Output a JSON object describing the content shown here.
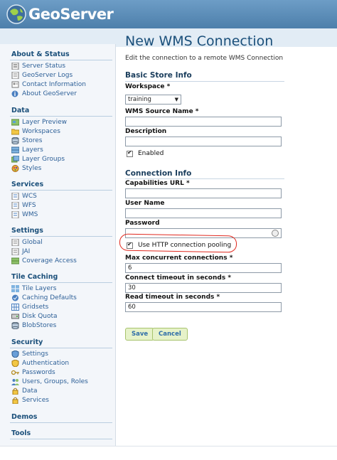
{
  "app": {
    "title": "GeoServer"
  },
  "sidebar": {
    "groups": [
      {
        "title": "About & Status",
        "items": [
          {
            "label": "Server Status",
            "icon": "server-status-icon"
          },
          {
            "label": "GeoServer Logs",
            "icon": "logs-icon"
          },
          {
            "label": "Contact Information",
            "icon": "contact-icon"
          },
          {
            "label": "About GeoServer",
            "icon": "about-icon"
          }
        ]
      },
      {
        "title": "Data",
        "items": [
          {
            "label": "Layer Preview",
            "icon": "layer-preview-icon"
          },
          {
            "label": "Workspaces",
            "icon": "folder-icon"
          },
          {
            "label": "Stores",
            "icon": "database-icon"
          },
          {
            "label": "Layers",
            "icon": "layers-icon"
          },
          {
            "label": "Layer Groups",
            "icon": "layer-groups-icon"
          },
          {
            "label": "Styles",
            "icon": "styles-icon"
          }
        ]
      },
      {
        "title": "Services",
        "items": [
          {
            "label": "WCS",
            "icon": "wcs-icon"
          },
          {
            "label": "WFS",
            "icon": "wfs-icon"
          },
          {
            "label": "WMS",
            "icon": "wms-icon"
          }
        ]
      },
      {
        "title": "Settings",
        "items": [
          {
            "label": "Global",
            "icon": "global-icon"
          },
          {
            "label": "JAI",
            "icon": "jai-icon"
          },
          {
            "label": "Coverage Access",
            "icon": "coverage-icon"
          }
        ]
      },
      {
        "title": "Tile Caching",
        "items": [
          {
            "label": "Tile Layers",
            "icon": "tile-layers-icon"
          },
          {
            "label": "Caching Defaults",
            "icon": "caching-defaults-icon"
          },
          {
            "label": "Gridsets",
            "icon": "gridsets-icon"
          },
          {
            "label": "Disk Quota",
            "icon": "disk-quota-icon"
          },
          {
            "label": "BlobStores",
            "icon": "blobstores-icon"
          }
        ]
      },
      {
        "title": "Security",
        "items": [
          {
            "label": "Settings",
            "icon": "security-settings-icon"
          },
          {
            "label": "Authentication",
            "icon": "authentication-icon"
          },
          {
            "label": "Passwords",
            "icon": "passwords-icon"
          },
          {
            "label": "Users, Groups, Roles",
            "icon": "users-icon"
          },
          {
            "label": "Data",
            "icon": "data-security-icon"
          },
          {
            "label": "Services",
            "icon": "services-security-icon"
          }
        ]
      },
      {
        "title": "Demos",
        "items": []
      },
      {
        "title": "Tools",
        "items": []
      }
    ]
  },
  "main": {
    "title": "New WMS Connection",
    "description": "Edit the connection to a remote WMS Connection",
    "basic_section": "Basic Store Info",
    "workspace_label": "Workspace *",
    "workspace_value": "training",
    "source_name_label": "WMS Source Name *",
    "source_name_value": "",
    "description_label": "Description",
    "description_value": "",
    "enabled_label": "Enabled",
    "connection_section": "Connection Info",
    "capabilities_label": "Capabilities URL *",
    "capabilities_value": "",
    "username_label": "User Name",
    "username_value": "",
    "password_label": "Password",
    "password_value": "",
    "pooling_label": "Use HTTP connection pooling",
    "max_conn_label": "Max concurrent connections *",
    "max_conn_value": "6",
    "connect_timeout_label": "Connect timeout in seconds *",
    "connect_timeout_value": "30",
    "read_timeout_label": "Read timeout in seconds *",
    "read_timeout_value": "60",
    "save_label": "Save",
    "cancel_label": "Cancel",
    "annotation_color": "#e0281e"
  }
}
